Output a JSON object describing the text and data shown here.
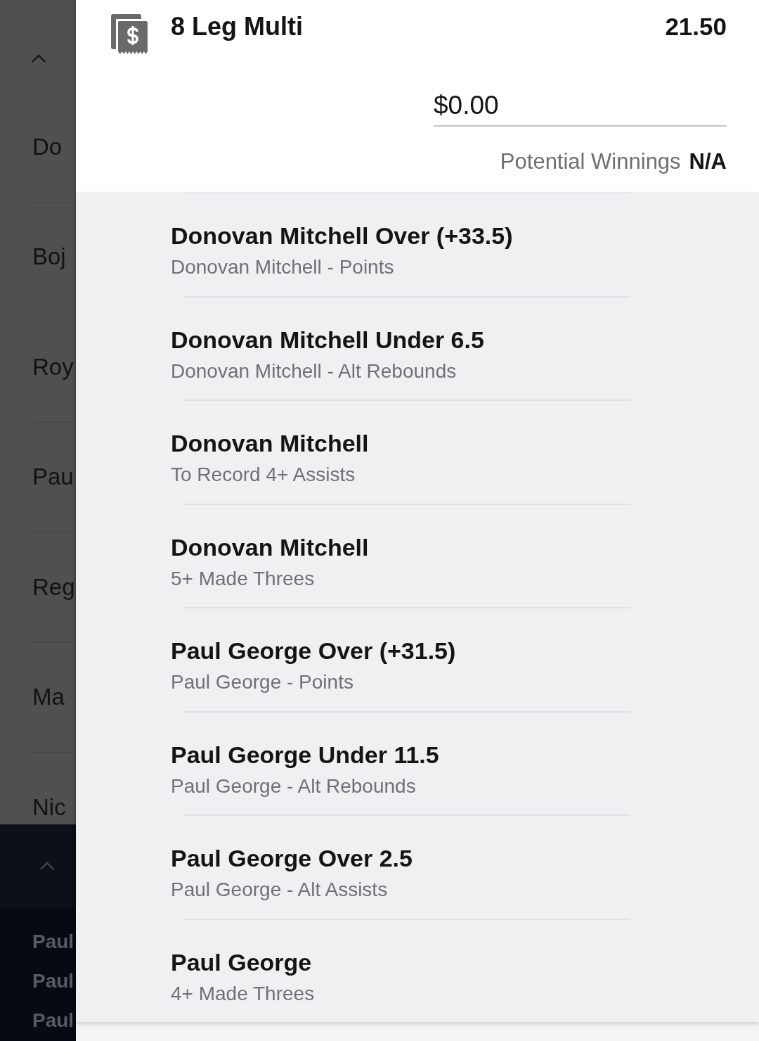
{
  "background_list": {
    "items": [
      "Do",
      "Boj",
      "Roy",
      "Pau",
      "Reg",
      "Ma",
      "Nic"
    ],
    "footer_items": [
      "Paul",
      "Paul",
      "Paul"
    ]
  },
  "bet_slip": {
    "title": "8 Leg Multi",
    "odds": "21.50",
    "stake": {
      "value": "$0.00"
    },
    "potential_winnings": {
      "label": "Potential Winnings",
      "value": "N/A"
    },
    "legs": [
      {
        "selection": "Donovan Mitchell Over (+33.5)",
        "market": "Donovan Mitchell - Points"
      },
      {
        "selection": "Donovan Mitchell Under 6.5",
        "market": "Donovan Mitchell - Alt Rebounds"
      },
      {
        "selection": "Donovan Mitchell",
        "market": "To Record 4+ Assists"
      },
      {
        "selection": "Donovan Mitchell",
        "market": "5+ Made Threes"
      },
      {
        "selection": "Paul George Over (+31.5)",
        "market": "Paul George - Points"
      },
      {
        "selection": "Paul George Under 11.5",
        "market": "Paul George - Alt Rebounds"
      },
      {
        "selection": "Paul George Over 2.5",
        "market": "Paul George - Alt Assists"
      },
      {
        "selection": "Paul George",
        "market": "4+ Made Threes"
      }
    ]
  }
}
